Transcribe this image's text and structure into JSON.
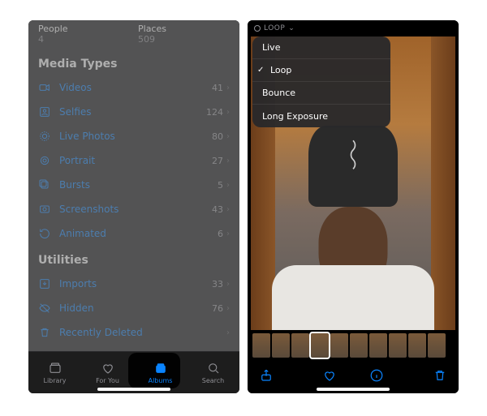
{
  "left": {
    "albums": [
      {
        "title": "People",
        "count": "4"
      },
      {
        "title": "Places",
        "count": "509"
      }
    ],
    "sections": {
      "media_types": {
        "header": "Media Types",
        "rows": [
          {
            "icon": "video-icon",
            "label": "Videos",
            "count": "41"
          },
          {
            "icon": "selfie-icon",
            "label": "Selfies",
            "count": "124"
          },
          {
            "icon": "livephoto-icon",
            "label": "Live Photos",
            "count": "80"
          },
          {
            "icon": "portrait-icon",
            "label": "Portrait",
            "count": "27"
          },
          {
            "icon": "burst-icon",
            "label": "Bursts",
            "count": "5"
          },
          {
            "icon": "screenshot-icon",
            "label": "Screenshots",
            "count": "43"
          },
          {
            "icon": "animated-icon",
            "label": "Animated",
            "count": "6"
          }
        ]
      },
      "utilities": {
        "header": "Utilities",
        "rows": [
          {
            "icon": "import-icon",
            "label": "Imports",
            "count": "33"
          },
          {
            "icon": "hidden-icon",
            "label": "Hidden",
            "count": "76"
          },
          {
            "icon": "trash-icon",
            "label": "Recently Deleted",
            "count": ""
          }
        ]
      }
    },
    "tabs": {
      "library": "Library",
      "foryou": "For You",
      "albums": "Albums",
      "search": "Search",
      "active": "albums"
    }
  },
  "right": {
    "effect_label": "LOOP",
    "menu": {
      "items": [
        "Live",
        "Loop",
        "Bounce",
        "Long Exposure"
      ],
      "selected": "Loop"
    },
    "bottom_icons": [
      "share-icon",
      "heart-icon",
      "info-icon",
      "trash-icon"
    ]
  }
}
